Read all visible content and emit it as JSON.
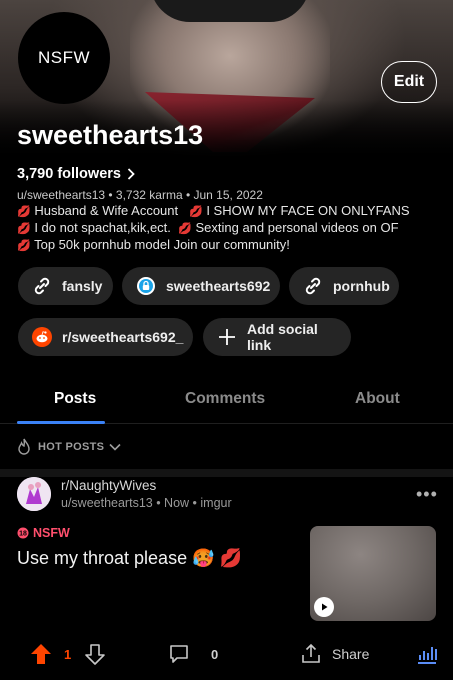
{
  "profile": {
    "avatar_text": "NSFW",
    "edit_label": "Edit",
    "username": "sweethearts13",
    "followers": "3,790 followers",
    "meta": "u/sweethearts13 • 3,732 karma • Jun 15, 2022",
    "bio_lines": [
      {
        "a": "Husband & Wife Account",
        "b": "I SHOW MY FACE ON ONLYFANS"
      },
      {
        "a": "I do not spachat,kik,ect.",
        "b": "Sexting and personal videos on OF"
      },
      {
        "a": "Top 50k pornhub model  Join our community!",
        "b": ""
      }
    ]
  },
  "social_links": [
    {
      "label": "fansly",
      "icon": "link-icon"
    },
    {
      "label": "sweethearts692",
      "icon": "onlyfans-lock-icon"
    },
    {
      "label": "pornhub",
      "icon": "link-icon"
    },
    {
      "label": "r/sweethearts692_",
      "icon": "reddit-icon"
    },
    {
      "label": "Add social link",
      "icon": "plus-icon"
    }
  ],
  "tabs": [
    "Posts",
    "Comments",
    "About"
  ],
  "sort": {
    "label": "HOT POSTS"
  },
  "post": {
    "subreddit": "r/NaughtyWives",
    "meta": "u/sweethearts13 • Now • imgur",
    "nsfw_label": "NSFW",
    "title": "Use my throat please",
    "title_emojis": "🥵 💋",
    "votes": "1",
    "comments": "0",
    "share_label": "Share"
  },
  "colors": {
    "accent_blue": "#3b82f6",
    "upvote_orange": "#ff4500",
    "nsfw_pink": "#ff4f6d",
    "chip_bg": "#252525"
  }
}
